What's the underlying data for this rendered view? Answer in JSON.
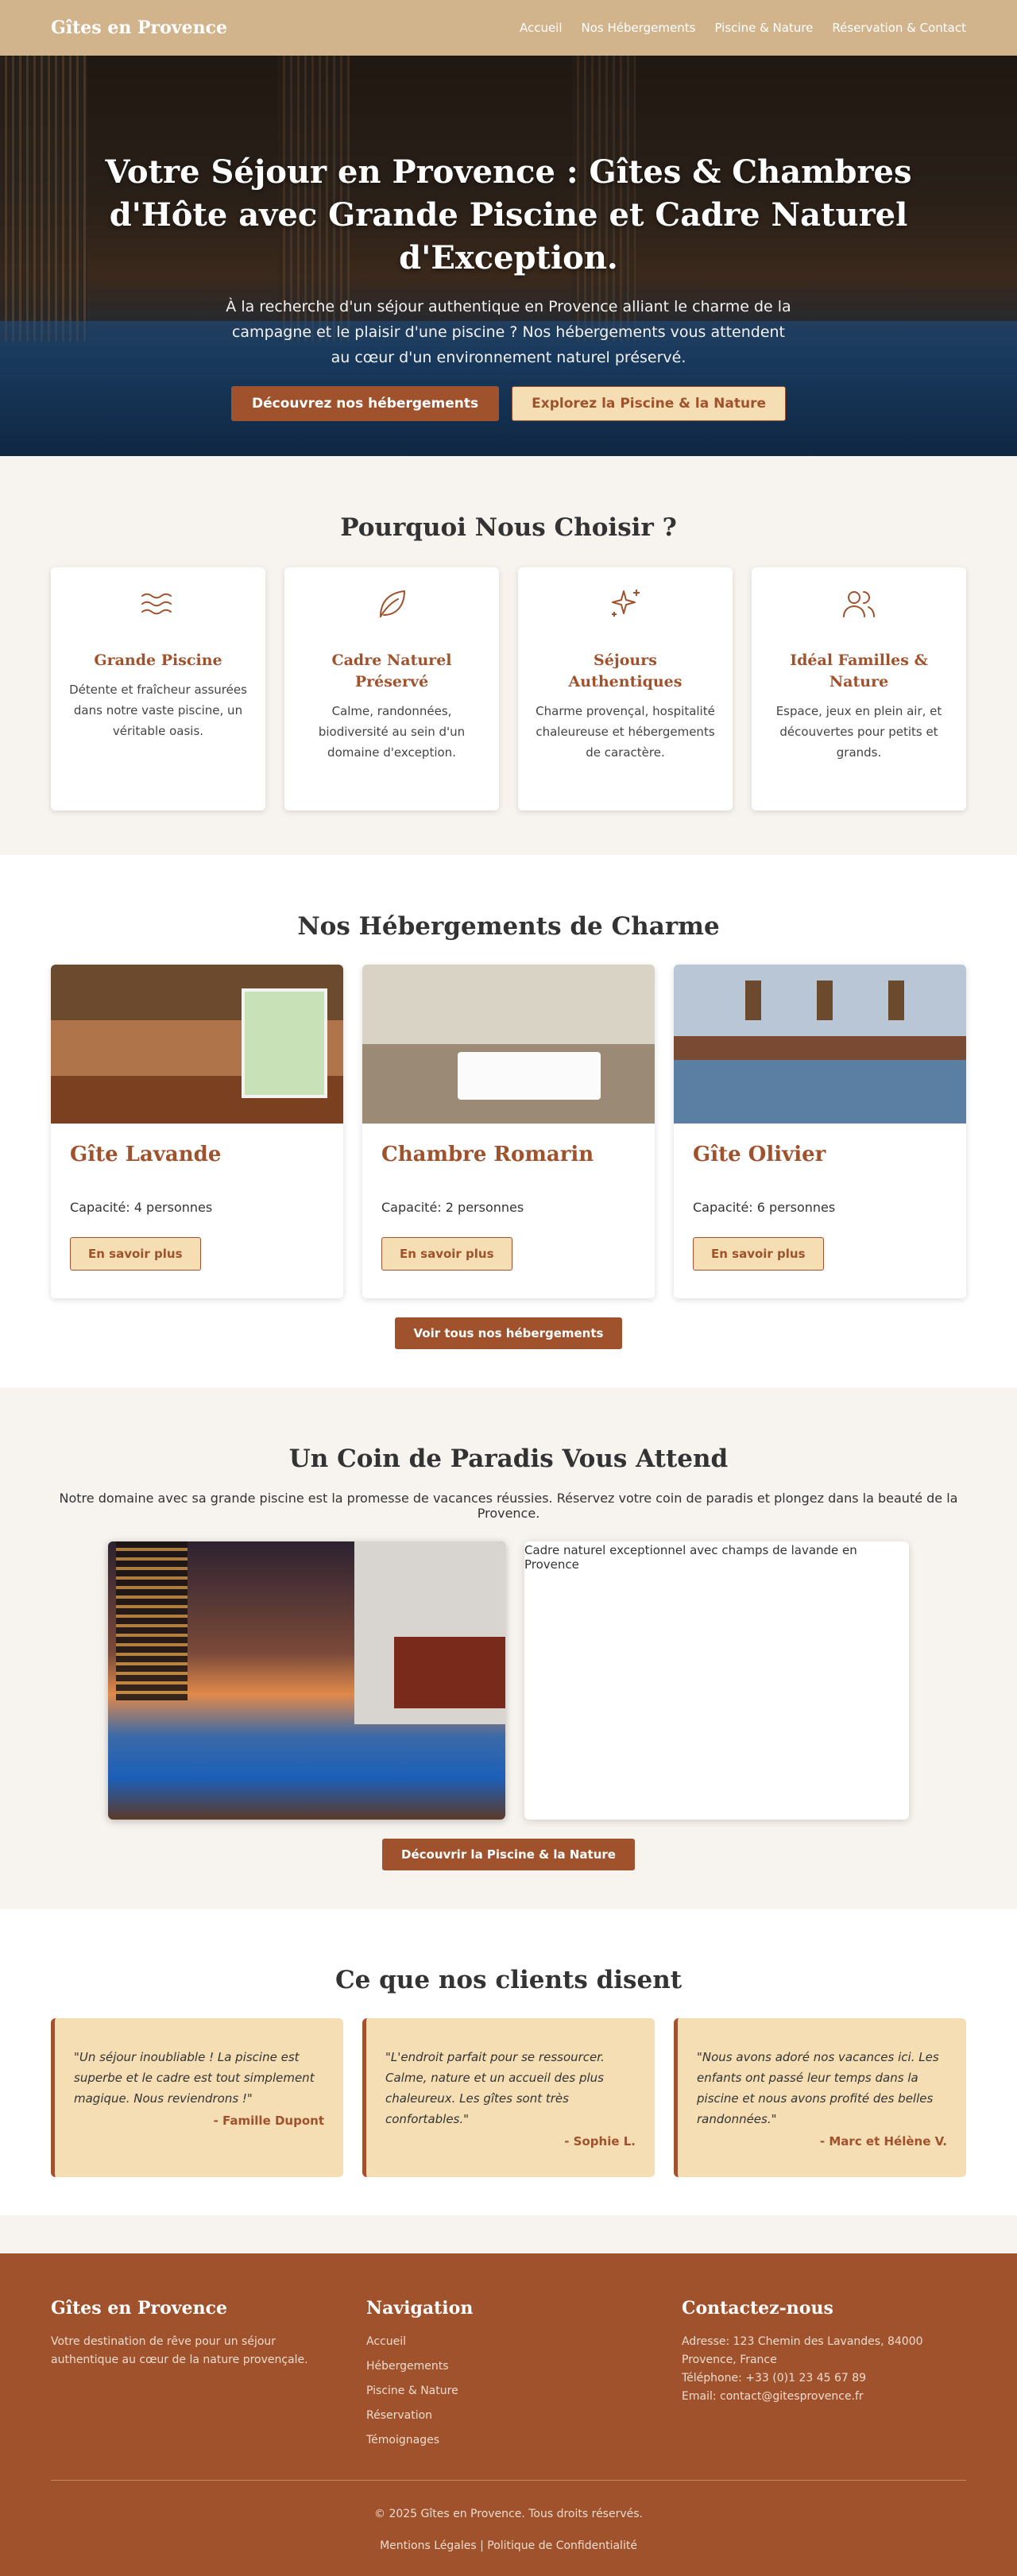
{
  "header": {
    "brand": "Gîtes en Provence",
    "nav": [
      "Accueil",
      "Nos Hébergements",
      "Piscine & Nature",
      "Réservation & Contact"
    ]
  },
  "hero": {
    "title": "Votre Séjour en Provence : Gîtes & Chambres d'Hôte avec Grande Piscine et Cadre Naturel d'Exception.",
    "subtitle": "À la recherche d'un séjour authentique en Provence alliant le charme de la campagne et le plaisir d'une piscine ? Nos hébergements vous attendent au cœur d'un environnement naturel préservé.",
    "primary_btn": "Découvrez nos hébergements",
    "secondary_btn": "Explorez la Piscine & la Nature"
  },
  "why": {
    "title": "Pourquoi Nous Choisir ?",
    "cards": [
      {
        "icon": "waves-icon",
        "title": "Grande Piscine",
        "text": "Détente et fraîcheur assurées dans notre vaste piscine, un véritable oasis."
      },
      {
        "icon": "leaf-icon",
        "title": "Cadre Naturel Préservé",
        "text": "Calme, randonnées, biodiversité au sein d'un domaine d'exception."
      },
      {
        "icon": "sparkles-icon",
        "title": "Séjours Authentiques",
        "text": "Charme provençal, hospitalité chaleureuse et hébergements de caractère."
      },
      {
        "icon": "users-icon",
        "title": "Idéal Familles & Nature",
        "text": "Espace, jeux en plein air, et découvertes pour petits et grands."
      }
    ]
  },
  "lodging": {
    "title": "Nos Hébergements de Charme",
    "cards": [
      {
        "name": "Gîte Lavande",
        "capacity": "Capacité: 4 personnes",
        "btn": "En savoir plus"
      },
      {
        "name": "Chambre Romarin",
        "capacity": "Capacité: 2 personnes",
        "btn": "En savoir plus"
      },
      {
        "name": "Gîte Olivier",
        "capacity": "Capacité: 6 personnes",
        "btn": "En savoir plus"
      }
    ],
    "all_btn": "Voir tous nos hébergements"
  },
  "paradise": {
    "title": "Un Coin de Paradis Vous Attend",
    "lead": "Notre domaine avec sa grande piscine est la promesse de vacances réussies. Réservez votre coin de paradis et plongez dans la beauté de la Provence.",
    "caption": "Cadre naturel exceptionnel avec champs de lavande en Provence",
    "btn": "Découvrir la Piscine & la Nature"
  },
  "testimonials": {
    "title": "Ce que nos clients disent",
    "items": [
      {
        "quote": "\"Un séjour inoubliable ! La piscine est superbe et le cadre est tout simplement magique. Nous reviendrons !\"",
        "author": "- Famille Dupont"
      },
      {
        "quote": "\"L'endroit parfait pour se ressourcer. Calme, nature et un accueil des plus chaleureux. Les gîtes sont très confortables.\"",
        "author": "- Sophie L."
      },
      {
        "quote": "\"Nous avons adoré nos vacances ici. Les enfants ont passé leur temps dans la piscine et nous avons profité des belles randonnées.\"",
        "author": "- Marc et Hélène V."
      }
    ]
  },
  "footer": {
    "brand": "Gîtes en Provence",
    "brand_text": "Votre destination de rêve pour un séjour authentique au cœur de la nature provençale.",
    "nav_title": "Navigation",
    "nav": [
      "Accueil",
      "Hébergements",
      "Piscine & Nature",
      "Réservation",
      "Témoignages"
    ],
    "contact_title": "Contactez-nous",
    "address": "Adresse: 123 Chemin des Lavandes, 84000 Provence, France",
    "phone": "Téléphone: +33 (0)1 23 45 67 89",
    "email": "Email: contact@gitesprovence.fr",
    "copyright": "© 2025 Gîtes en Provence. Tous droits réservés.",
    "legal1": "Mentions Légales",
    "legal_sep": "|",
    "legal2": "Politique de Confidentialité"
  },
  "colors": {
    "accent": "#a0522d",
    "header_bg": "#d2b48c",
    "light": "#f5deb3",
    "section_bg": "#f7f3ee"
  }
}
